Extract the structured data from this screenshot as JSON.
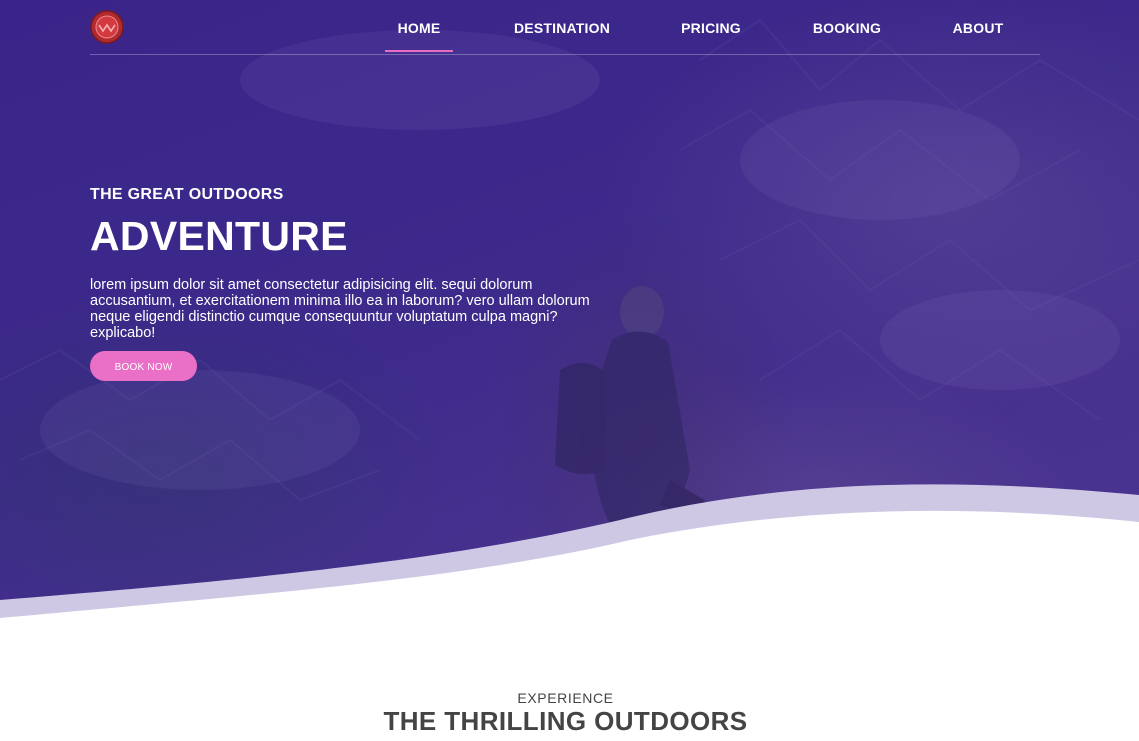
{
  "nav": {
    "logo_icon": "circular-red-emblem-logo",
    "items": [
      {
        "label": "HOME",
        "active": true
      },
      {
        "label": "DESTINATION",
        "active": false
      },
      {
        "label": "PRICING",
        "active": false
      },
      {
        "label": "BOOKING",
        "active": false
      },
      {
        "label": "ABOUT",
        "active": false
      }
    ]
  },
  "hero": {
    "subtitle": "THE GREAT OUTDOORS",
    "title": "ADVENTURE",
    "description": "lorem ipsum dolor sit amet consectetur adipisicing elit. sequi dolorum accusantium, et exercitationem minima illo ea in laborum? vero ullam dolorum neque eligendi distinctio cumque consequuntur voluptatum culpa magni? explicabo!",
    "button_label": "BOOK NOW"
  },
  "section": {
    "subtitle": "EXPERIENCE",
    "title": "THE THRILLING OUTDOORS"
  },
  "colors": {
    "overlay_purple": "#3d2a8b",
    "accent_pink": "#ea6fc6",
    "wave_lavender": "#cfc8e4",
    "heading_gray": "#444444"
  }
}
